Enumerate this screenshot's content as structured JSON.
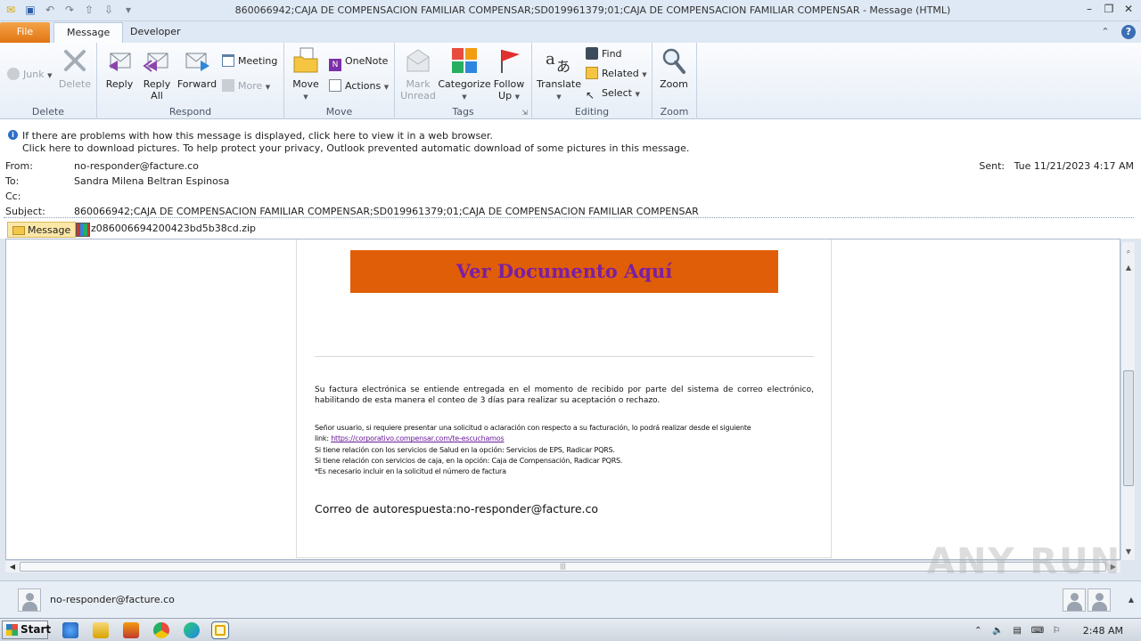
{
  "window": {
    "title": "860066942;CAJA DE COMPENSACION FAMILIAR COMPENSAR;SD019961379;01;CAJA DE COMPENSACION FAMILIAR COMPENSAR  -  Message (HTML)"
  },
  "tabs": {
    "file": "File",
    "message": "Message",
    "developer": "Developer"
  },
  "ribbon": {
    "delete_group": {
      "label": "Delete",
      "junk": "Junk",
      "delete": "Delete"
    },
    "respond_group": {
      "label": "Respond",
      "reply": "Reply",
      "reply_all_1": "Reply",
      "reply_all_2": "All",
      "forward": "Forward",
      "meeting": "Meeting",
      "more": "More"
    },
    "move_group": {
      "label": "Move",
      "move": "Move",
      "onenote": "OneNote",
      "actions": "Actions"
    },
    "tags_group": {
      "label": "Tags",
      "mark_unread_1": "Mark",
      "mark_unread_2": "Unread",
      "categorize": "Categorize",
      "follow_up_1": "Follow",
      "follow_up_2": "Up"
    },
    "editing_group": {
      "label": "Editing",
      "translate": "Translate",
      "find": "Find",
      "related": "Related",
      "select": "Select"
    },
    "zoom_group": {
      "label": "Zoom",
      "zoom": "Zoom"
    }
  },
  "infobar": {
    "line1": "If there are problems with how this message is displayed, click here to view it in a web browser.",
    "line2": "Click here to download pictures. To help protect your privacy, Outlook prevented automatic download of some pictures in this message."
  },
  "header": {
    "from_label": "From:",
    "from": "no-responder@facture.co",
    "to_label": "To:",
    "to": "Sandra Milena Beltran Espinosa",
    "cc_label": "Cc:",
    "cc": "",
    "subject_label": "Subject:",
    "subject": "860066942;CAJA DE COMPENSACION FAMILIAR COMPENSAR;SD019961379;01;CAJA DE COMPENSACION FAMILIAR COMPENSAR",
    "sent_label": "Sent:",
    "sent": "Tue 11/21/2023 4:17 AM"
  },
  "attachments": {
    "message_tab": "Message",
    "file": "z086006694200423bd5b38cd.zip"
  },
  "body": {
    "banner": "Ver Documento Aquí",
    "p1": "Su factura electrónica se entiende entregada en el momento de recibido por parte del sistema de correo electrónico, habilitando de esta manera el conteo de 3 días para realizar su aceptación o rechazo.",
    "p2_line1": "Señor usuario, si requiere presentar una solicitud o aclaración con respecto a su facturación, lo podrá realizar desde el siguiente",
    "p2_link_prefix": "link: ",
    "p2_link": "https://corporativo.compensar.com/te-escuchamos",
    "p2_line3": "Si tiene relación con los servicios de Salud en la opción: Servicios de EPS, Radicar PQRS.",
    "p2_line4": "Si tiene relación con servicios de caja, en la opción: Caja de Compensación, Radicar PQRS.",
    "p2_line5": "*Es necesario incluir en la solicitud el número de factura",
    "autoresponse": "Correo de autorespuesta:no-responder@facture.co"
  },
  "people_pane": {
    "name": "no-responder@facture.co"
  },
  "watermark": "ANY RUN",
  "taskbar": {
    "start": "Start",
    "clock": "2:48 AM"
  }
}
